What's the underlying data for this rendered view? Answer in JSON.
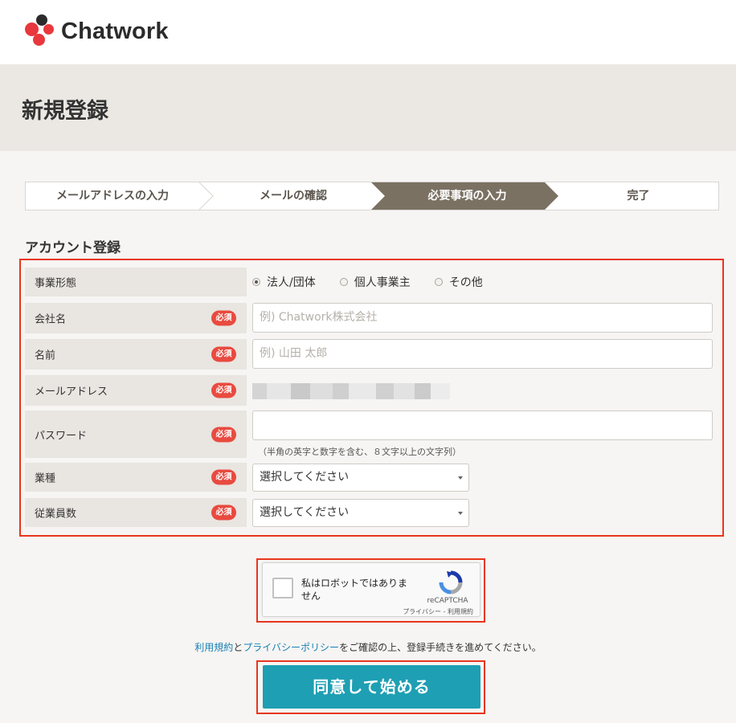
{
  "brand": {
    "name": "Chatwork"
  },
  "page": {
    "title": "新規登録"
  },
  "steps": [
    "メールアドレスの入力",
    "メールの確認",
    "必要事項の入力",
    "完了"
  ],
  "current_step": "必要事項の入力",
  "section": {
    "title": "アカウント登録"
  },
  "form": {
    "required_badge": "必須",
    "business_type": {
      "label": "事業形態",
      "options": [
        "法人/団体",
        "個人事業主",
        "その他"
      ],
      "selected": "法人/団体"
    },
    "company": {
      "label": "会社名",
      "placeholder": "例) Chatwork株式会社"
    },
    "name": {
      "label": "名前",
      "placeholder": "例) 山田 太郎"
    },
    "email": {
      "label": "メールアドレス"
    },
    "password": {
      "label": "パスワード",
      "hint": "（半角の英字と数字を含む、８文字以上の文字列）"
    },
    "industry": {
      "label": "業種",
      "value": "選択してください"
    },
    "employees": {
      "label": "従業員数",
      "value": "選択してください"
    }
  },
  "recaptcha": {
    "checkbox_label": "私はロボットではありません",
    "brand": "reCAPTCHA",
    "links": "プライバシー - 利用規約"
  },
  "agreement": {
    "terms_link": "利用規約",
    "and": "と",
    "privacy_link": "プライバシーポリシー",
    "rest": "をご確認の上、登録手続きを進めてください。"
  },
  "submit": {
    "label": "同意して始める"
  },
  "colors": {
    "accent_button": "#1e9fb3",
    "highlight_border": "#e8361d",
    "required_badge": "#e94a3f",
    "active_step": "#7a7163",
    "link": "#1a80b6"
  }
}
